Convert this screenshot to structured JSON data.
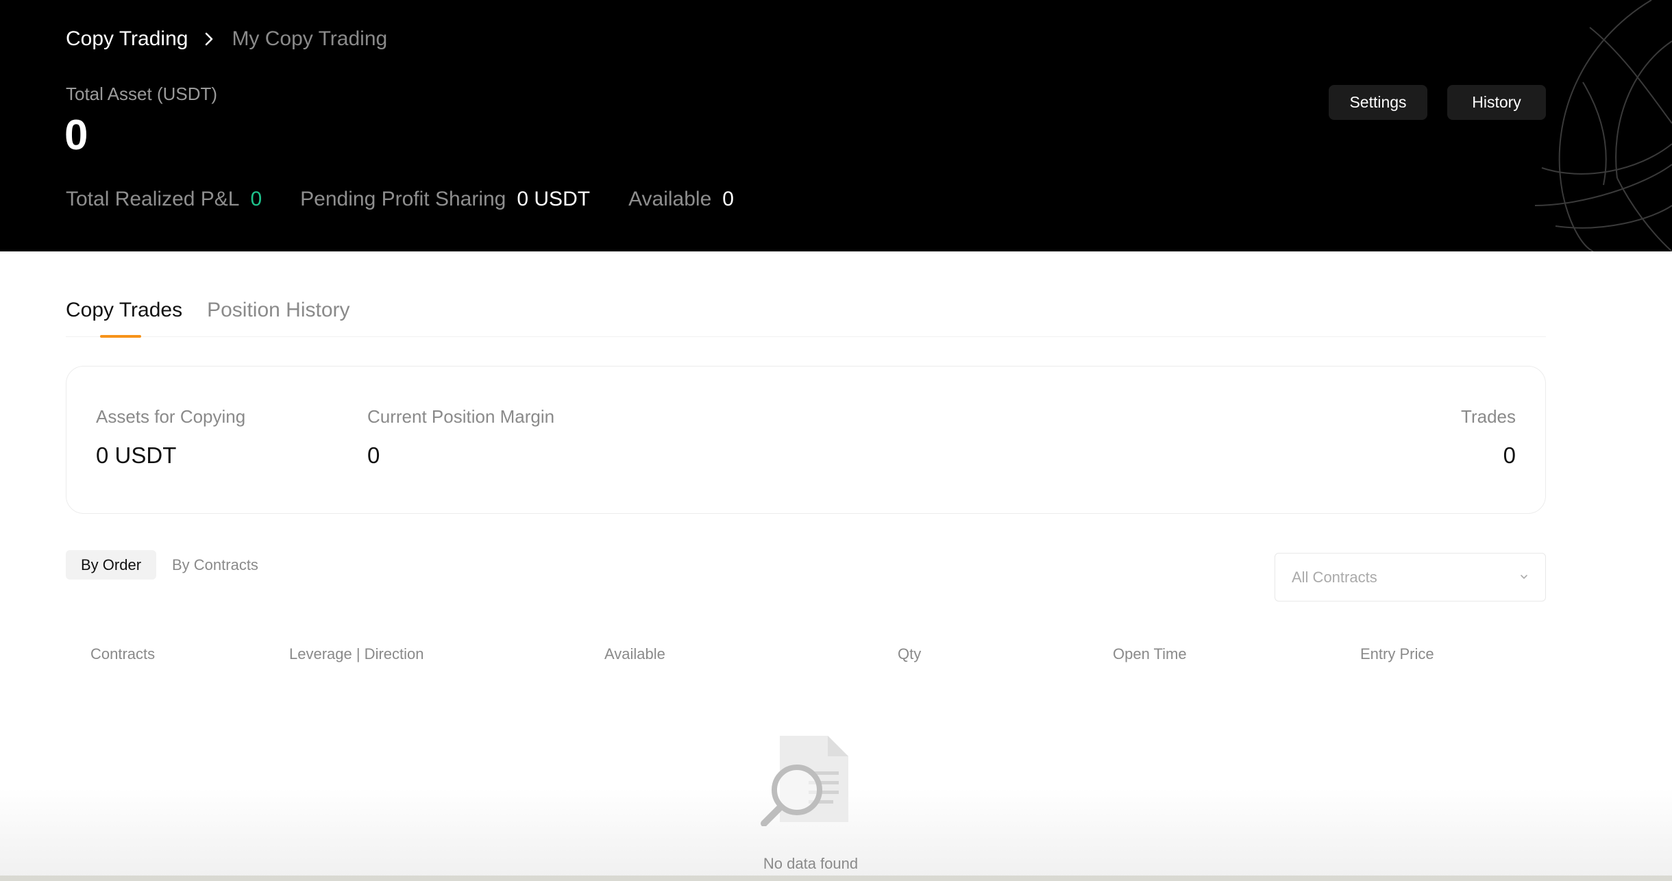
{
  "header": {
    "breadcrumb": {
      "root": "Copy Trading",
      "current": "My Copy Trading",
      "separator_icon": "chevron-right-icon"
    },
    "total_asset_label": "Total Asset (USDT)",
    "total_asset_value": "0",
    "stats": {
      "realized_pnl_label": "Total Realized P&L",
      "realized_pnl_value": "0",
      "pending_label": "Pending Profit Sharing",
      "pending_value": "0 USDT",
      "available_label": "Available",
      "available_value": "0"
    },
    "buttons": {
      "settings": "Settings",
      "history": "History"
    }
  },
  "tabs": [
    {
      "label": "Copy Trades",
      "active": true
    },
    {
      "label": "Position History",
      "active": false
    }
  ],
  "summary": {
    "assets_label": "Assets for Copying",
    "assets_value": "0 USDT",
    "margin_label": "Current Position Margin",
    "margin_value": "0",
    "trades_label": "Trades",
    "trades_value": "0"
  },
  "filters": {
    "segments": [
      "By Order",
      "By Contracts"
    ],
    "selected_segment": "By Order",
    "contract_select": {
      "value": "All Contracts",
      "icon": "chevron-down-icon"
    }
  },
  "table": {
    "columns": [
      "Contracts",
      "Leverage | Direction",
      "Available",
      "Qty",
      "Open Time",
      "Entry Price"
    ],
    "rows": [],
    "empty_text": "No data found",
    "empty_icon": "document-search-icon"
  },
  "colors": {
    "accent": "#f7931a",
    "positive": "#1ec28b",
    "hero_background": "#000000"
  }
}
